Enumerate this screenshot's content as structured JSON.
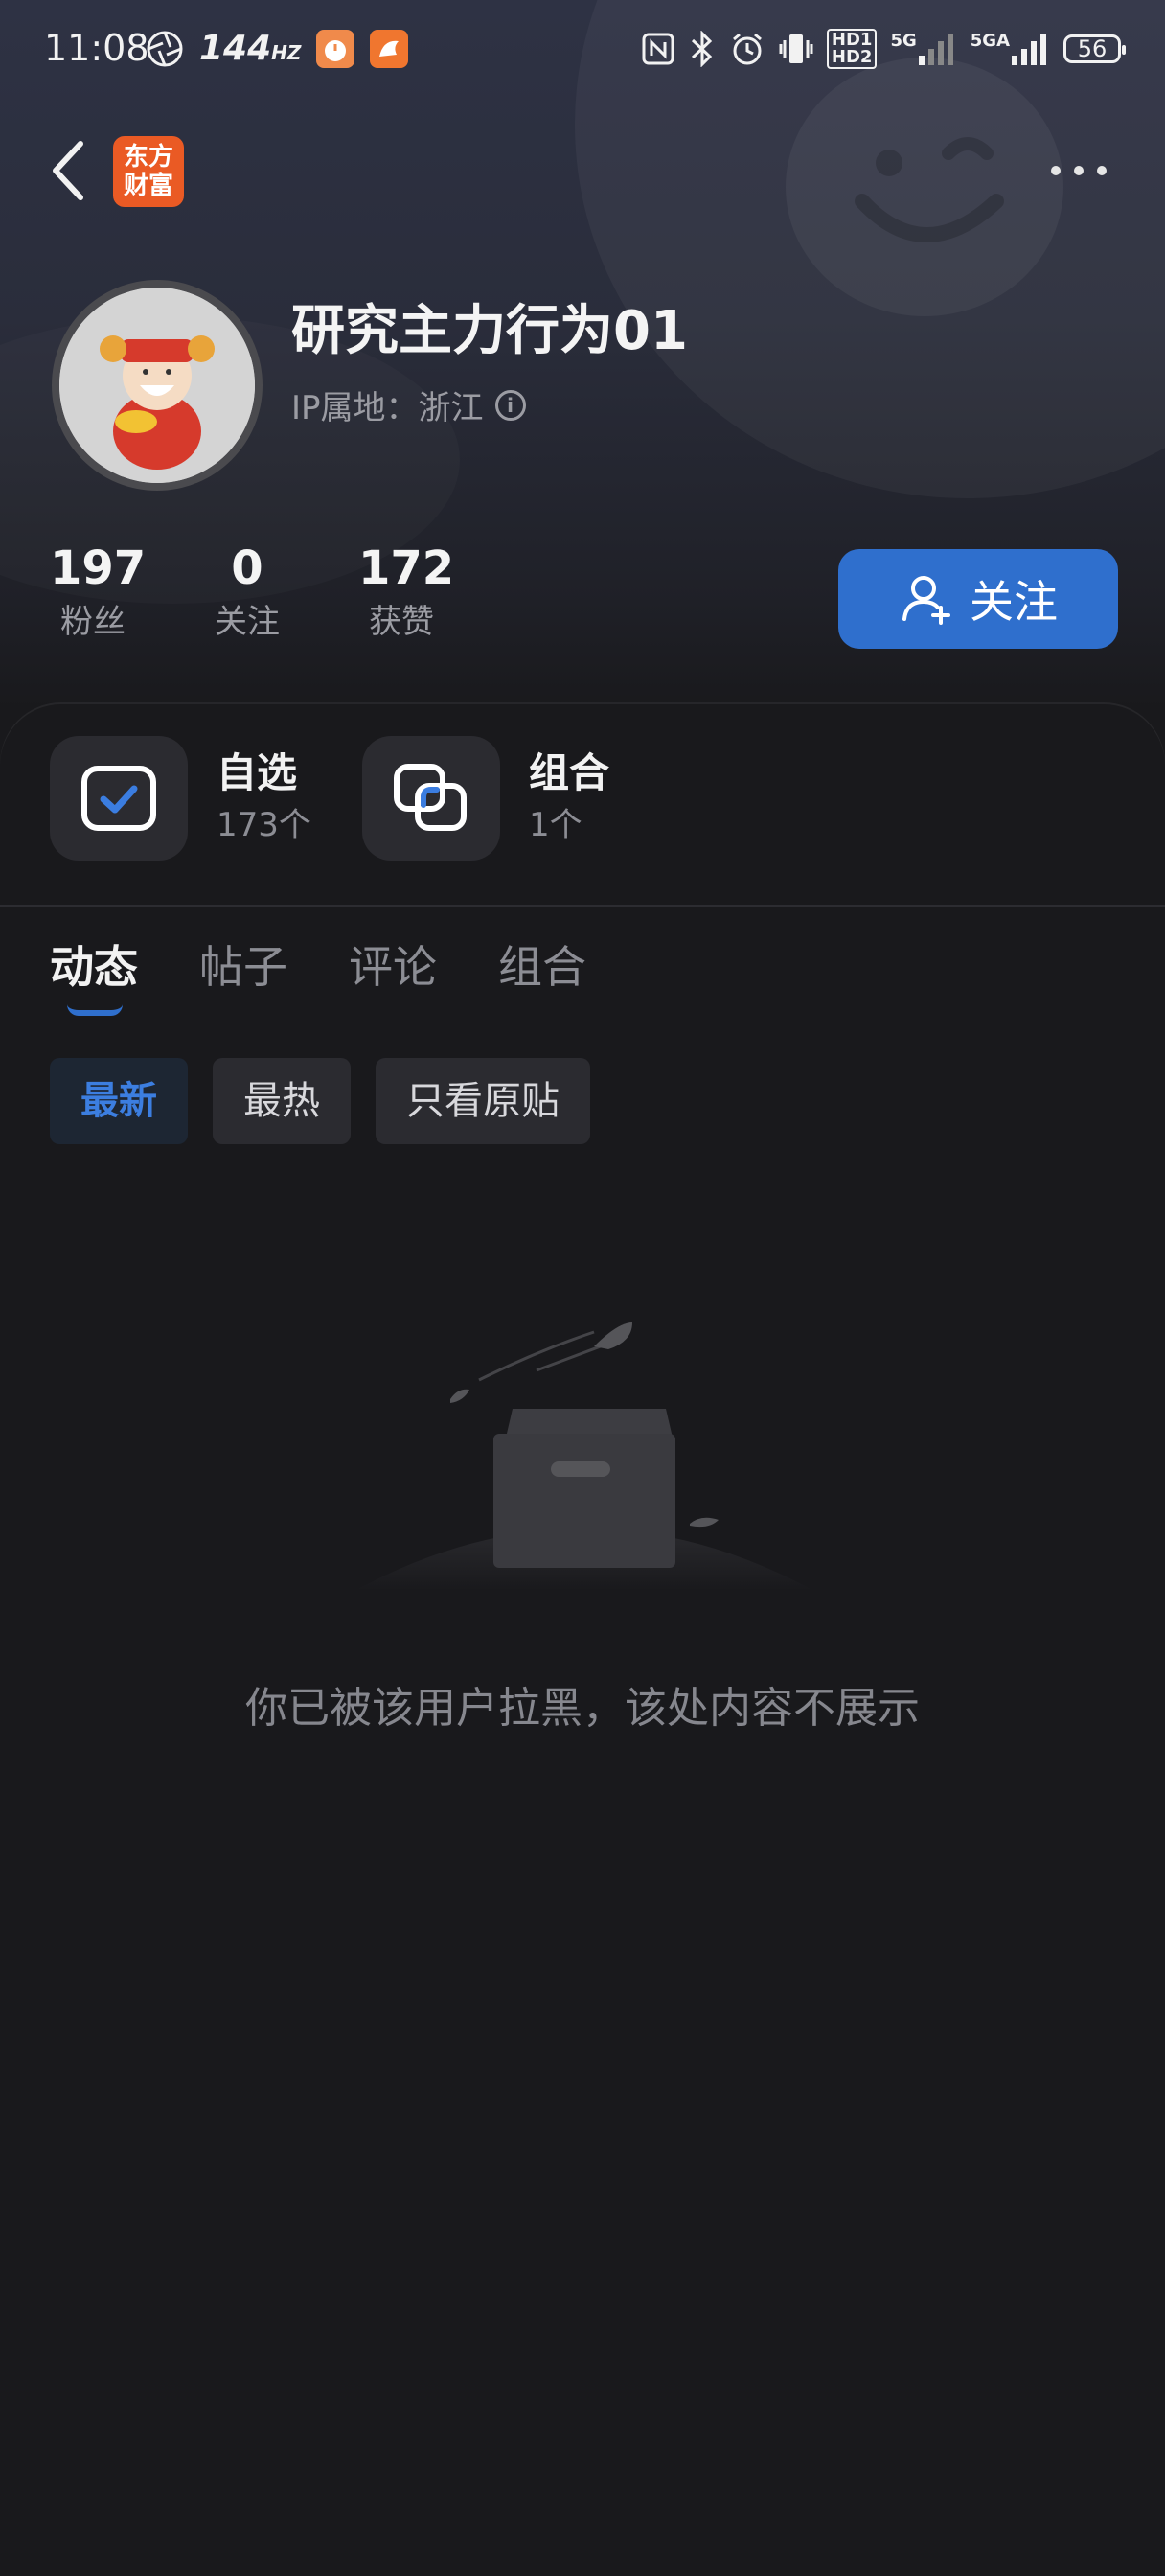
{
  "status_bar": {
    "time": "11:08",
    "refresh_rate": "144",
    "refresh_unit": "HZ",
    "hd1": "HD1",
    "hd2": "HD2",
    "net1": "5G",
    "net2": "5GA",
    "battery": "56"
  },
  "nav": {
    "logo_line1": "东方",
    "logo_line2": "财富"
  },
  "profile": {
    "username": "研究主力行为01",
    "ip_location": "IP属地：浙江",
    "info_icon": "i"
  },
  "stats": [
    {
      "value": "197",
      "label": "粉丝"
    },
    {
      "value": "0",
      "label": "关注"
    },
    {
      "value": "172",
      "label": "获赞"
    }
  ],
  "follow_button": {
    "label": "关注"
  },
  "shortcuts": [
    {
      "title": "自选",
      "subtitle": "173个",
      "icon": "checkbox-icon"
    },
    {
      "title": "组合",
      "subtitle": "1个",
      "icon": "portfolio-icon"
    }
  ],
  "tabs": [
    {
      "label": "动态",
      "active": true
    },
    {
      "label": "帖子",
      "active": false
    },
    {
      "label": "评论",
      "active": false
    },
    {
      "label": "组合",
      "active": false
    }
  ],
  "filters": [
    {
      "label": "最新",
      "active": true
    },
    {
      "label": "最热",
      "active": false
    },
    {
      "label": "只看原贴",
      "active": false
    }
  ],
  "empty_state": {
    "message": "你已被该用户拉黑，该处内容不展示"
  },
  "colors": {
    "accent": "#2f6fcd",
    "logo": "#ea5a24",
    "background": "#19191c"
  }
}
